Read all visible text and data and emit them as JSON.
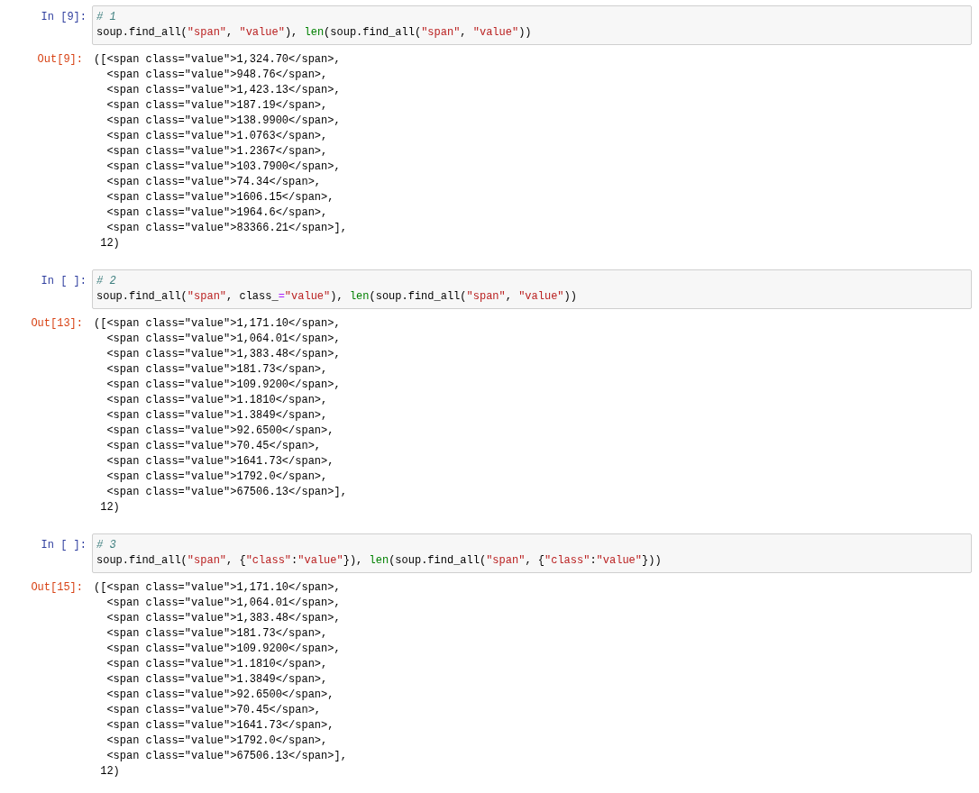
{
  "cells": [
    {
      "input_prompt": "In [9]:",
      "code": [
        [
          {
            "kind": "comment",
            "text": "# 1"
          }
        ],
        [
          {
            "kind": "plain",
            "text": "soup.find_all("
          },
          {
            "kind": "string",
            "text": "\"span\""
          },
          {
            "kind": "plain",
            "text": ", "
          },
          {
            "kind": "string",
            "text": "\"value\""
          },
          {
            "kind": "plain",
            "text": "), "
          },
          {
            "kind": "builtin",
            "text": "len"
          },
          {
            "kind": "plain",
            "text": "(soup.find_all("
          },
          {
            "kind": "string",
            "text": "\"span\""
          },
          {
            "kind": "plain",
            "text": ", "
          },
          {
            "kind": "string",
            "text": "\"value\""
          },
          {
            "kind": "plain",
            "text": "))"
          }
        ]
      ],
      "output_prompt": "Out[9]:",
      "output": [
        "([<span class=\"value\">1,324.70</span>,",
        "  <span class=\"value\">948.76</span>,",
        "  <span class=\"value\">1,423.13</span>,",
        "  <span class=\"value\">187.19</span>,",
        "  <span class=\"value\">138.9900</span>,",
        "  <span class=\"value\">1.0763</span>,",
        "  <span class=\"value\">1.2367</span>,",
        "  <span class=\"value\">103.7900</span>,",
        "  <span class=\"value\">74.34</span>,",
        "  <span class=\"value\">1606.15</span>,",
        "  <span class=\"value\">1964.6</span>,",
        "  <span class=\"value\">83366.21</span>],",
        " 12)"
      ]
    },
    {
      "input_prompt": "In [ ]:",
      "code": [
        [
          {
            "kind": "comment",
            "text": "# 2"
          }
        ],
        [
          {
            "kind": "plain",
            "text": "soup.find_all("
          },
          {
            "kind": "string",
            "text": "\"span\""
          },
          {
            "kind": "plain",
            "text": ", class_"
          },
          {
            "kind": "operator",
            "text": "="
          },
          {
            "kind": "string",
            "text": "\"value\""
          },
          {
            "kind": "plain",
            "text": "), "
          },
          {
            "kind": "builtin",
            "text": "len"
          },
          {
            "kind": "plain",
            "text": "(soup.find_all("
          },
          {
            "kind": "string",
            "text": "\"span\""
          },
          {
            "kind": "plain",
            "text": ", "
          },
          {
            "kind": "string",
            "text": "\"value\""
          },
          {
            "kind": "plain",
            "text": "))"
          }
        ]
      ],
      "output_prompt": "Out[13]:",
      "output": [
        "([<span class=\"value\">1,171.10</span>,",
        "  <span class=\"value\">1,064.01</span>,",
        "  <span class=\"value\">1,383.48</span>,",
        "  <span class=\"value\">181.73</span>,",
        "  <span class=\"value\">109.9200</span>,",
        "  <span class=\"value\">1.1810</span>,",
        "  <span class=\"value\">1.3849</span>,",
        "  <span class=\"value\">92.6500</span>,",
        "  <span class=\"value\">70.45</span>,",
        "  <span class=\"value\">1641.73</span>,",
        "  <span class=\"value\">1792.0</span>,",
        "  <span class=\"value\">67506.13</span>],",
        " 12)"
      ]
    },
    {
      "input_prompt": "In [ ]:",
      "code": [
        [
          {
            "kind": "comment",
            "text": "# 3"
          }
        ],
        [
          {
            "kind": "plain",
            "text": "soup.find_all("
          },
          {
            "kind": "string",
            "text": "\"span\""
          },
          {
            "kind": "plain",
            "text": ", {"
          },
          {
            "kind": "string",
            "text": "\"class\""
          },
          {
            "kind": "plain",
            "text": ":"
          },
          {
            "kind": "string",
            "text": "\"value\""
          },
          {
            "kind": "plain",
            "text": "}), "
          },
          {
            "kind": "builtin",
            "text": "len"
          },
          {
            "kind": "plain",
            "text": "(soup.find_all("
          },
          {
            "kind": "string",
            "text": "\"span\""
          },
          {
            "kind": "plain",
            "text": ", {"
          },
          {
            "kind": "string",
            "text": "\"class\""
          },
          {
            "kind": "plain",
            "text": ":"
          },
          {
            "kind": "string",
            "text": "\"value\""
          },
          {
            "kind": "plain",
            "text": "}))"
          }
        ]
      ],
      "output_prompt": "Out[15]:",
      "output": [
        "([<span class=\"value\">1,171.10</span>,",
        "  <span class=\"value\">1,064.01</span>,",
        "  <span class=\"value\">1,383.48</span>,",
        "  <span class=\"value\">181.73</span>,",
        "  <span class=\"value\">109.9200</span>,",
        "  <span class=\"value\">1.1810</span>,",
        "  <span class=\"value\">1.3849</span>,",
        "  <span class=\"value\">92.6500</span>,",
        "  <span class=\"value\">70.45</span>,",
        "  <span class=\"value\">1641.73</span>,",
        "  <span class=\"value\">1792.0</span>,",
        "  <span class=\"value\">67506.13</span>],",
        " 12)"
      ]
    }
  ]
}
